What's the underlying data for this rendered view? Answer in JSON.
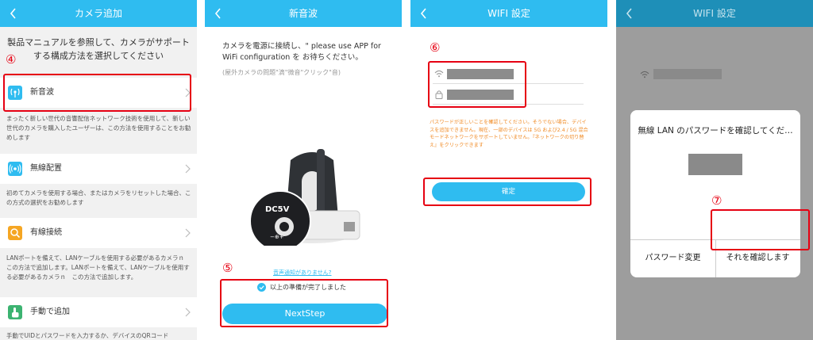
{
  "panel1": {
    "title": "カメラ追加",
    "intro": "製品マニュアルを参照して、カメラがサポートする構成方法を選択してください",
    "step_marker": "④",
    "items": [
      {
        "label": "新音波",
        "desc": "まったく新しい世代の音響配信ネットワーク技術を使用して、新しい世代のカメラを購入したユーザーは、この方法を使用することをお勧めします"
      },
      {
        "label": "無線配置",
        "desc": "初めてカメラを使用する場合、またはカメラをリセットした場合、この方式の選択をお勧めします"
      },
      {
        "label": "有線接続",
        "desc": "LANポートを備えて、LANケーブルを使用する必要があるカメラｎ　この方法で追加します。LANポートを備えて、LANケーブルを使用する必要があるカメラｎ　この方法で追加します。"
      },
      {
        "label": "手動で追加",
        "desc": "手動でUIDとパスワードを入力するか、デバイスのQRコード"
      }
    ]
  },
  "panel2": {
    "title": "新音波",
    "instruction": "カメラを電源に接続し、\" please use APP for WiFi configuration を お待ちください。",
    "sub_note": "(屋外カメラの問題\"滴\"微音\"クリック\"音)",
    "port_label": "DC5V",
    "polarity": "−⊕+",
    "link": "音声通知がありません?",
    "step_marker": "⑤",
    "checkbox_label": "以上の準備が完了しました",
    "next_button": "NextStep"
  },
  "panel3": {
    "title": "WIFI 設定",
    "step_marker": "⑥",
    "warning": "パスワードが正しいことを確認してください。そうでない場合、デバイスを追加できません。現在、一部のデバイスは 5G および2.4 / 5G 混合モードネットワークをサポートしていません。『ネットワークの切り替え』をクリックできます",
    "confirm_button": "確定"
  },
  "panel4": {
    "title": "WIFI 設定",
    "dialog_title": "無線 LAN のパスワードを確認してくだ…",
    "step_marker": "⑦",
    "change_button": "パスワード変更",
    "confirm_button": "それを確認します"
  },
  "colors": {
    "accent": "#2fbcf0",
    "highlight": "#e60012",
    "warning": "#f08a24"
  }
}
